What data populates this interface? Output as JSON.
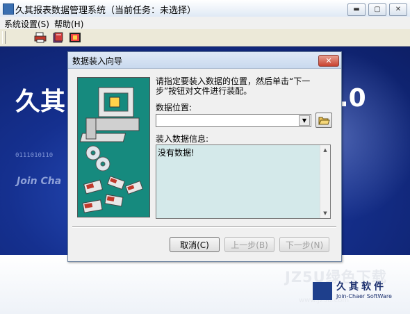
{
  "window": {
    "title": "久其报表数据管理系统（当前任务：未选择）",
    "controls": {
      "minimize": "▬",
      "maximize": "▢",
      "close": "✕"
    }
  },
  "menu": {
    "items": [
      {
        "label": "系统设置(S)"
      },
      {
        "label": "帮助(H)"
      }
    ]
  },
  "toolbar": {
    "icons": [
      "printer-icon",
      "book-icon",
      "film-icon"
    ]
  },
  "background": {
    "headline_left": "久其",
    "headline_right": ".0",
    "binary_text": "0111010110",
    "join_text": "Join Cha",
    "logo_cn": "久其软件",
    "logo_en": "Join-Chaer SoftWare",
    "watermark": "JZ5U绿色下载",
    "watermark_url": "www.jz5u.com"
  },
  "dialog": {
    "title": "数据装入向导",
    "close_label": "✕",
    "instruction": "请指定要装入数据的位置，然后单击“下一步”按钮对文件进行装配。",
    "location_label": "数据位置:",
    "location_value": "",
    "info_label": "装入数据信息:",
    "info_text": "没有数据!",
    "buttons": {
      "cancel": "取消(C)",
      "prev": "上一步(B)",
      "next": "下一步(N)"
    }
  },
  "colors": {
    "dialog_bg": "#f0f0f0",
    "art_bg": "#168a7e",
    "info_bg": "#d4e9ea",
    "background_blue": "#15308f"
  }
}
